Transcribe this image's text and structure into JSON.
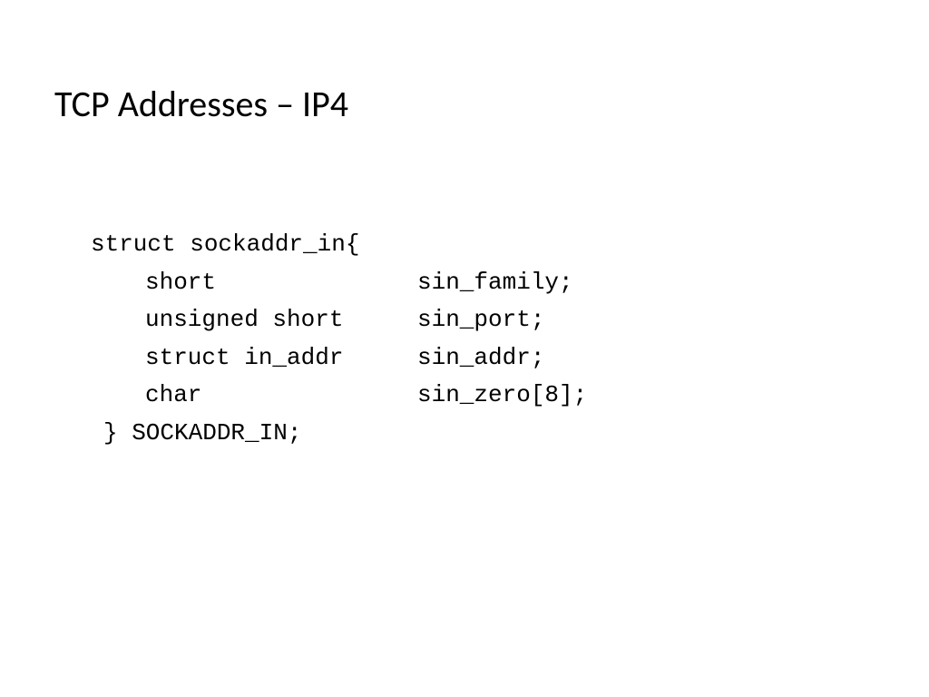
{
  "slide": {
    "title": "TCP Addresses – IP4",
    "code": {
      "open": "struct sockaddr_in{",
      "fields": [
        {
          "type": "short",
          "name": "sin_family;"
        },
        {
          "type": "unsigned short",
          "name": "sin_port;"
        },
        {
          "type": "struct in_addr",
          "name": "sin_addr;"
        },
        {
          "type": "char",
          "name": "sin_zero[8];"
        }
      ],
      "close": "} SOCKADDR_IN;"
    }
  }
}
